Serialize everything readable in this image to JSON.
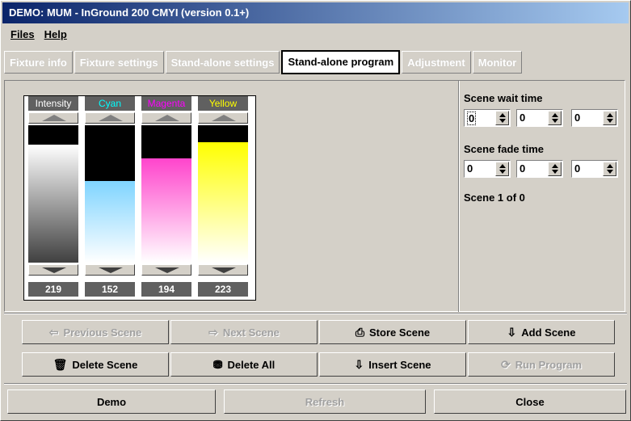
{
  "window": {
    "title": "DEMO: MUM - InGround 200 CMYI (version 0.1+)"
  },
  "menu": {
    "files": "Files",
    "help": "Help"
  },
  "tabs": [
    {
      "label": "Fixture info",
      "active": false
    },
    {
      "label": "Fixture settings",
      "active": false
    },
    {
      "label": "Stand-alone settings",
      "active": false
    },
    {
      "label": "Stand-alone program",
      "active": true
    },
    {
      "label": "Adjustment",
      "active": false
    },
    {
      "label": "Monitor",
      "active": false
    }
  ],
  "faders": [
    {
      "label": "Intensity",
      "label_color": "#ffffff",
      "value": "219",
      "level": 219,
      "fill": "linear-gradient(to bottom,#ffffff,#404040)"
    },
    {
      "label": "Cyan",
      "label_color": "#00ffff",
      "value": "152",
      "level": 152,
      "fill": "linear-gradient(to bottom,#7fd4ff,#ffffff)"
    },
    {
      "label": "Magenta",
      "label_color": "#ff00ff",
      "value": "194",
      "level": 194,
      "fill": "linear-gradient(to bottom,#ff44cc,#ffffff)"
    },
    {
      "label": "Yellow",
      "label_color": "#ffff00",
      "value": "223",
      "level": 223,
      "fill": "linear-gradient(to bottom,#ffff00,#ffffff)"
    }
  ],
  "scene": {
    "wait_label": "Scene wait time",
    "wait": [
      "0",
      "0",
      "0"
    ],
    "fade_label": "Scene fade time",
    "fade": [
      "0",
      "0",
      "0"
    ],
    "status": "Scene 1 of 0"
  },
  "buttons": {
    "previous": "Previous Scene",
    "next": "Next Scene",
    "store": "Store Scene",
    "add": "Add Scene",
    "delete": "Delete Scene",
    "delete_all": "Delete All",
    "insert": "Insert Scene",
    "run": "Run Program"
  },
  "footer": {
    "demo": "Demo",
    "refresh": "Refresh",
    "close": "Close"
  }
}
